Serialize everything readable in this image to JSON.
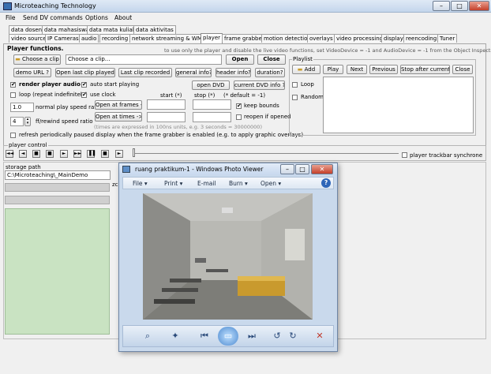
{
  "app": {
    "title": "Microteaching Technology"
  },
  "menu": [
    "File",
    "Send DV commands",
    "Options",
    "About"
  ],
  "tabs_row1": [
    "data dosen",
    "data mahasiswa",
    "data mata kuliah",
    "data aktivitas"
  ],
  "tabs_row2": [
    "video source",
    "IP Cameras",
    "audio",
    "recording",
    "network streaming & WMV",
    "player",
    "frame grabber",
    "motion detection",
    "overlays",
    "video processing",
    "display",
    "reencoding",
    "Tuner"
  ],
  "player": {
    "heading": "Player functions.",
    "info": "to use only the player and disable the live video functions, set VideoDevice = -1 and AudioDevice = -1 from the Object Inspector.",
    "choose_clip": "Choose a clip",
    "clip_value": "Choose a clip...",
    "open": "Open",
    "close": "Close",
    "demo_url": "demo URL ?",
    "open_last": "Open last clip played",
    "last_recorded": "Last clip recorded",
    "general_info": "general info?",
    "header_info": "header info?",
    "duration": "duration?",
    "render_audio": "render player audio",
    "auto_start": "auto start playing",
    "open_dvd": "open DVD",
    "current_dvd": "current DVD info ?",
    "loop": "loop (repeat indefinitely)",
    "use_clock": "use clock",
    "start_label": "start (*)",
    "stop_label": "stop (*)",
    "default_note": "(* default = -1)",
    "speed_value": "1.0",
    "speed_label": "normal play speed ratio",
    "open_frames": "Open at frames ->",
    "keep_bounds": "keep bounds",
    "rewind_value": "4",
    "rewind_label": "ff/rewind speed ratio",
    "open_times": "Open at times ->",
    "reopen": "reopen if opened",
    "times_note": "(times are expressed in 100ns units, e.g. 3 seconds = 30000000)",
    "refresh": "refresh periodically paused display when the frame grabber is enabled (e.g. to apply graphic overlays)"
  },
  "playlist": {
    "title": "Playlist",
    "add": "Add",
    "play": "Play",
    "next": "Next",
    "previous": "Previous",
    "stop_current": "Stop after current",
    "close": "Close",
    "loop": "Loop",
    "random": "Random"
  },
  "player_control": {
    "title": "player control",
    "trackbar_sync": "player trackbar synchrone",
    "buttons": [
      "◄◄",
      "◄",
      "■",
      "■",
      "►",
      "►►",
      "▐▐",
      "■",
      "►"
    ]
  },
  "storage": {
    "label": "storage path",
    "value": "C:\\Microteaching\\_MainDemo",
    "zoom_text": "zc"
  },
  "viewer": {
    "title": "ruang praktikum-1 - Windows Photo Viewer",
    "menu": [
      "File ▾",
      "Print ▾",
      "E-mail",
      "Burn ▾",
      "Open ▾"
    ],
    "help": "?"
  },
  "colors": {
    "grid": "#c9e3c2",
    "viewer_frame": "#c9d9ec"
  }
}
